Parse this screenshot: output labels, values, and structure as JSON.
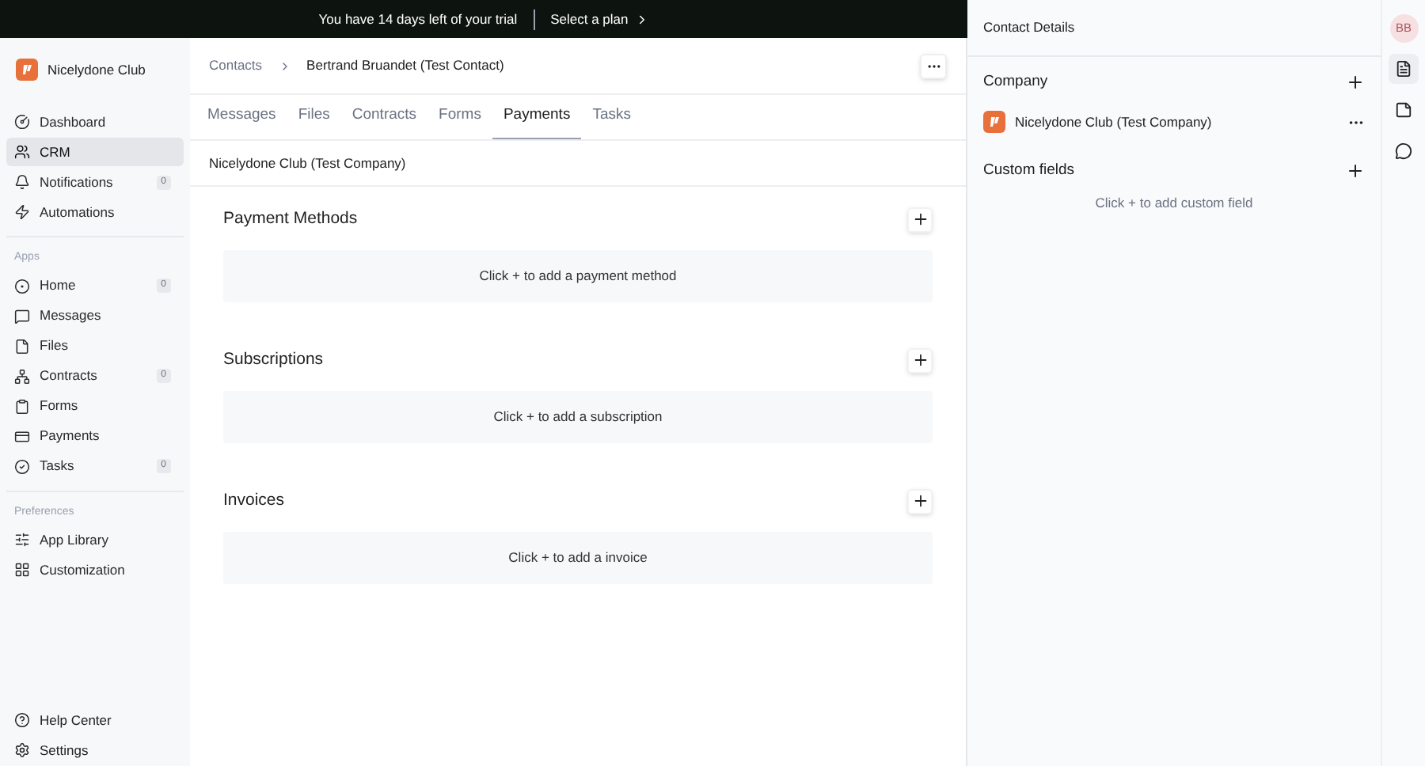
{
  "trial_banner": {
    "message": "You have 14 days left of your trial",
    "action": "Select a plan"
  },
  "sidebar": {
    "workspace": "Nicelydone Club",
    "sections": [
      {
        "items": [
          {
            "label": "Dashboard",
            "selected": false
          },
          {
            "label": "CRM",
            "selected": true
          },
          {
            "label": "Notifications",
            "selected": false,
            "badge": "0"
          },
          {
            "label": "Automations",
            "selected": false
          }
        ]
      },
      {
        "title": "Apps",
        "items": [
          {
            "label": "Home",
            "selected": false,
            "badge": "0"
          },
          {
            "label": "Messages",
            "selected": false
          },
          {
            "label": "Files",
            "selected": false
          },
          {
            "label": "Contracts",
            "selected": false,
            "badge": "0"
          },
          {
            "label": "Forms",
            "selected": false
          },
          {
            "label": "Payments",
            "selected": false
          },
          {
            "label": "Tasks",
            "selected": false,
            "badge": "0"
          }
        ]
      },
      {
        "title": "Preferences",
        "items": [
          {
            "label": "App Library",
            "selected": false
          },
          {
            "label": "Customization",
            "selected": false
          }
        ]
      }
    ],
    "footer": [
      {
        "label": "Help Center"
      },
      {
        "label": "Settings"
      }
    ]
  },
  "breadcrumb": [
    "Contacts",
    "Bertrand Bruandet (Test Contact)"
  ],
  "tabs": [
    {
      "label": "Messages",
      "selected": false
    },
    {
      "label": "Files",
      "selected": false
    },
    {
      "label": "Contracts",
      "selected": false
    },
    {
      "label": "Forms",
      "selected": false
    },
    {
      "label": "Payments",
      "selected": true
    },
    {
      "label": "Tasks",
      "selected": false
    }
  ],
  "company_bar": "Nicelydone Club (Test Company)",
  "sections": [
    {
      "title": "Payment Methods",
      "empty": "Click + to add a payment method"
    },
    {
      "title": "Subscriptions",
      "empty": "Click + to add a subscription"
    },
    {
      "title": "Invoices",
      "empty": "Click + to add a invoice"
    }
  ],
  "details": {
    "title": "Contact Details",
    "company_heading": "Company",
    "company": "Nicelydone Club (Test Company)",
    "custom_heading": "Custom fields",
    "custom_empty": "Click + to add custom field"
  },
  "rail": {
    "avatar": "BB",
    "items": [
      {
        "selected": true
      },
      {
        "selected": false
      },
      {
        "selected": false
      }
    ]
  }
}
